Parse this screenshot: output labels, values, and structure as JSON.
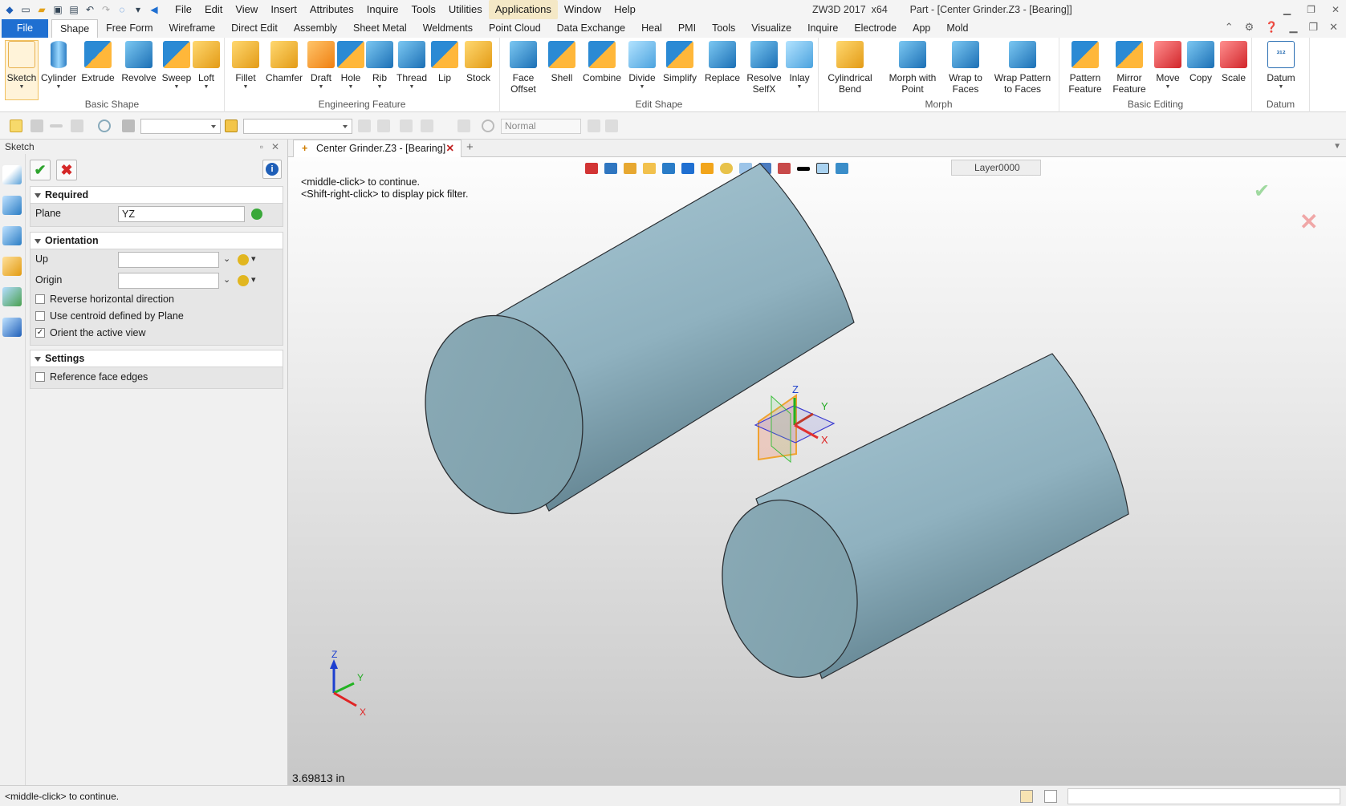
{
  "window": {
    "title": "ZW3D 2017  x64        Part - [Center Grinder.Z3 - [Bearing]]"
  },
  "menubar": [
    "File",
    "Edit",
    "View",
    "Insert",
    "Attributes",
    "Inquire",
    "Tools",
    "Utilities",
    "Applications",
    "Window",
    "Help"
  ],
  "ribbon_tabs": [
    "File",
    "Shape",
    "Free Form",
    "Wireframe",
    "Direct Edit",
    "Assembly",
    "Sheet Metal",
    "Weldments",
    "Point Cloud",
    "Data Exchange",
    "Heal",
    "PMI",
    "Tools",
    "Visualize",
    "Inquire",
    "Electrode",
    "App",
    "Mold"
  ],
  "active_tab": "Shape",
  "ribbon_groups": [
    {
      "label": "Basic Shape",
      "buttons": [
        "Sketch",
        "Cylinder",
        "Extrude",
        "Revolve",
        "Sweep",
        "Loft"
      ]
    },
    {
      "label": "Engineering Feature",
      "buttons": [
        "Fillet",
        "Chamfer",
        "Draft",
        "Hole",
        "Rib",
        "Thread",
        "Lip",
        "Stock"
      ]
    },
    {
      "label": "Edit Shape",
      "buttons": [
        "Face\nOffset",
        "Shell",
        "Combine",
        "Divide",
        "Simplify",
        "Replace",
        "Resolve\nSelfX",
        "Inlay"
      ]
    },
    {
      "label": "Morph",
      "buttons": [
        "Cylindrical\nBend",
        "Morph with\nPoint",
        "Wrap to\nFaces",
        "Wrap Pattern\nto Faces"
      ]
    },
    {
      "label": "Basic Editing",
      "buttons": [
        "Pattern\nFeature",
        "Mirror\nFeature",
        "Move",
        "Copy",
        "Scale"
      ]
    },
    {
      "label": "Datum",
      "buttons": [
        "Datum"
      ]
    }
  ],
  "toolbar": {
    "render_mode": "Normal"
  },
  "panel": {
    "title": "Sketch",
    "sections": {
      "required": "Required",
      "orientation": "Orientation",
      "settings": "Settings"
    },
    "fields": {
      "plane_label": "Plane",
      "plane_value": "YZ",
      "up_label": "Up",
      "up_value": "",
      "origin_label": "Origin",
      "origin_value": ""
    },
    "checkboxes": {
      "reverse": {
        "label": "Reverse horizontal direction",
        "checked": false
      },
      "centroid": {
        "label": "Use centroid defined by Plane",
        "checked": false
      },
      "orient": {
        "label": "Orient the active view",
        "checked": true
      },
      "refedges": {
        "label": "Reference face edges",
        "checked": false
      }
    }
  },
  "document_tab": "Center Grinder.Z3 - [Bearing]",
  "viewport": {
    "prompt_line1": "<middle-click> to continue.",
    "prompt_line2": "<Shift-right-click> to display pick filter.",
    "layer": "Layer0000",
    "measurement": "3.69813 in",
    "axis_labels": {
      "x": "X",
      "y": "Y",
      "z": "Z"
    }
  },
  "statusbar": {
    "message": "<middle-click> to continue."
  },
  "colors": {
    "accent": "#1f6fd1",
    "part_surface": "#95b9c6",
    "background_top": "#fdfdfd",
    "background_bottom": "#c7c7c7"
  }
}
